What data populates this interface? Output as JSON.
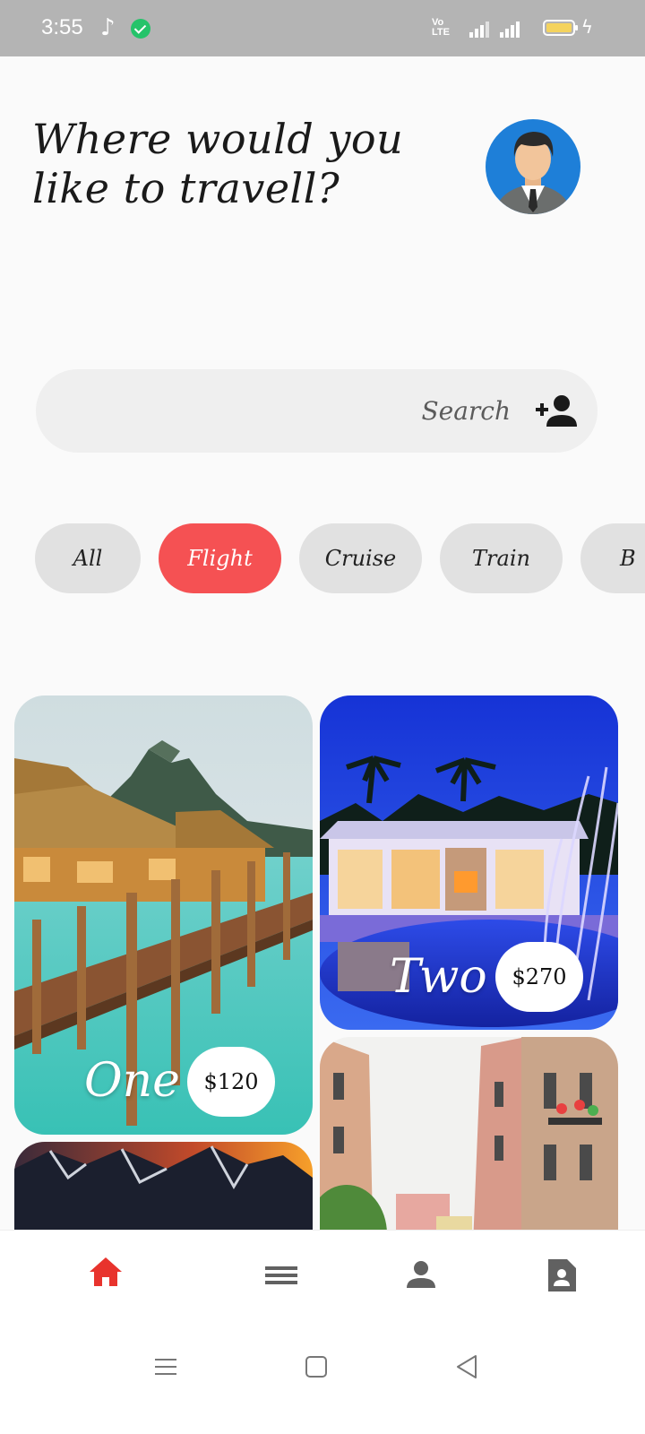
{
  "status_bar": {
    "time": "3:55",
    "network_label": "VoLTE 4G"
  },
  "header": {
    "title_line1": "Where would you",
    "title_line2": "like to travell?"
  },
  "search": {
    "placeholder": "Search"
  },
  "categories": [
    {
      "label": "All",
      "active": false
    },
    {
      "label": "Flight",
      "active": true
    },
    {
      "label": "Cruise",
      "active": false
    },
    {
      "label": "Train",
      "active": false
    },
    {
      "label": "B",
      "active": false
    }
  ],
  "cards": [
    {
      "label": "One",
      "price": "$120"
    },
    {
      "label": "Two",
      "price": "$270"
    }
  ],
  "colors": {
    "accent": "#f55153",
    "chip_bg": "#e1e1e1",
    "search_bg": "#efefef",
    "avatar_bg": "#1e7fd8",
    "nav_active": "#e8332d",
    "nav_inactive": "#616161"
  },
  "bottom_nav": [
    {
      "icon": "home-icon",
      "active": true
    },
    {
      "icon": "menu-icon",
      "active": false
    },
    {
      "icon": "person-icon",
      "active": false
    },
    {
      "icon": "contact-icon",
      "active": false
    }
  ],
  "system_nav": [
    {
      "icon": "recents-icon"
    },
    {
      "icon": "home-square-icon"
    },
    {
      "icon": "back-icon"
    }
  ]
}
